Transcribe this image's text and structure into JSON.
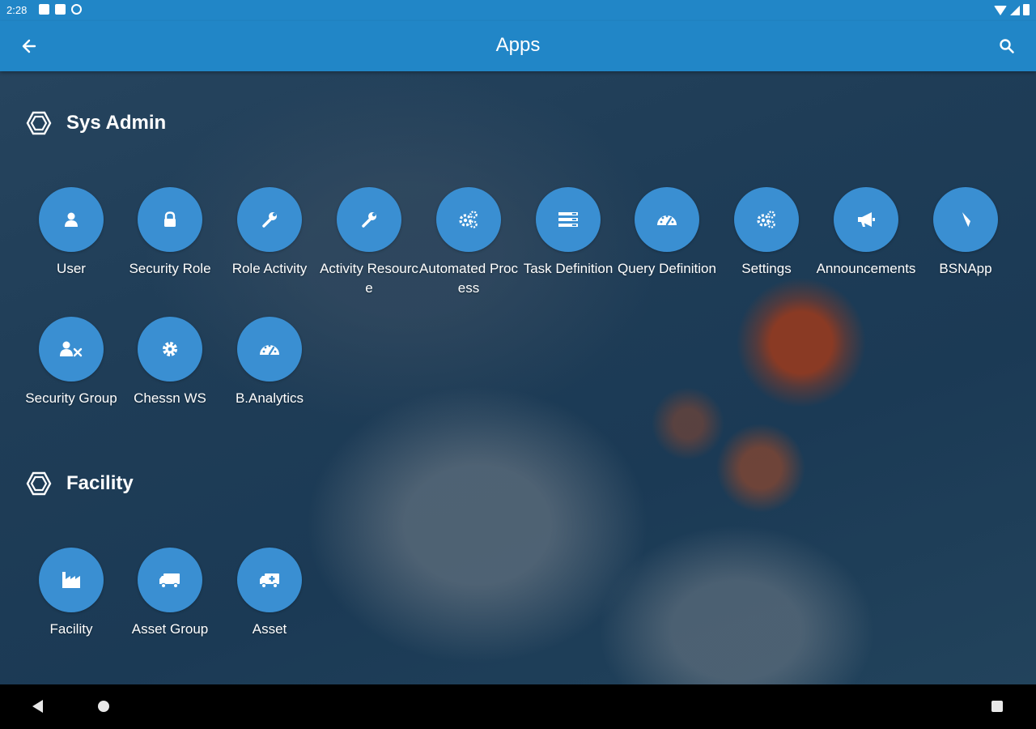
{
  "status_bar": {
    "time": "2:28"
  },
  "header": {
    "title": "Apps",
    "back_icon": "arrow-back-icon",
    "search_icon": "search-icon"
  },
  "sections": [
    {
      "title": "Sys Admin",
      "icon": "hexagon-icon",
      "apps": [
        {
          "label": "User",
          "icon": "user-icon"
        },
        {
          "label": "Security Role",
          "icon": "lock-icon"
        },
        {
          "label": "Role Activity",
          "icon": "wrench-icon"
        },
        {
          "label": "Activity Resource",
          "icon": "wrench-icon"
        },
        {
          "label": "Automated Process",
          "icon": "gears-icon"
        },
        {
          "label": "Task Definition",
          "icon": "list-icon"
        },
        {
          "label": "Query Definition",
          "icon": "dashboard-icon"
        },
        {
          "label": "Settings",
          "icon": "gears-icon"
        },
        {
          "label": "Announcements",
          "icon": "megaphone-icon"
        },
        {
          "label": "BSNApp",
          "icon": "compass-icon"
        },
        {
          "label": "Security Group",
          "icon": "users-x-icon"
        },
        {
          "label": "Chessn WS",
          "icon": "gear-icon"
        },
        {
          "label": "B.Analytics",
          "icon": "dashboard-icon"
        }
      ]
    },
    {
      "title": "Facility",
      "icon": "hexagon-icon",
      "apps": [
        {
          "label": "Facility",
          "icon": "factory-icon"
        },
        {
          "label": "Asset Group",
          "icon": "truck-icon"
        },
        {
          "label": "Asset",
          "icon": "ambulance-icon"
        }
      ]
    }
  ],
  "colors": {
    "primary": "#2186c7",
    "app_circle": "#3a8fd2",
    "background": "#1f3d57"
  }
}
